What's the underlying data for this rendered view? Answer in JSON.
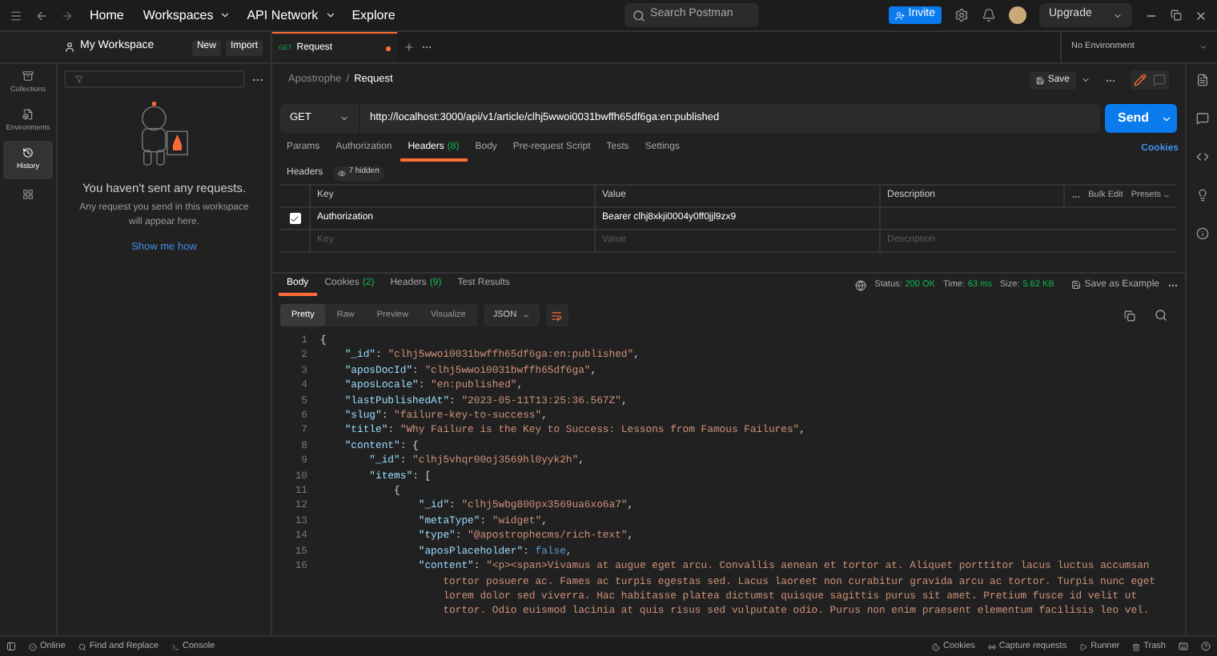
{
  "top_bar": {
    "nav": [
      {
        "label": "Home",
        "has_menu": false
      },
      {
        "label": "Workspaces",
        "has_menu": true
      },
      {
        "label": "API Network",
        "has_menu": true
      },
      {
        "label": "Explore",
        "has_menu": false
      }
    ],
    "search": {
      "placeholder": "Search Postman"
    },
    "invite": "Invite",
    "upgrade": "Upgrade"
  },
  "workspace": {
    "name": "My Workspace",
    "buttons": [
      "New",
      "Import"
    ]
  },
  "rail": [
    {
      "label": "Collections",
      "selected": false
    },
    {
      "label": "Environments",
      "selected": false
    },
    {
      "label": "History",
      "selected": true
    }
  ],
  "empty_state": {
    "title": "You haven't sent any requests.",
    "text": "Any request you send in this workspace will appear here.",
    "link": "Show me how"
  },
  "tabs": [
    {
      "method": "GET",
      "title": "Request",
      "selected": true,
      "unsaved": true
    }
  ],
  "environment": "No Environment",
  "breadcrumb": {
    "parent": "Apostrophe",
    "separator": "/",
    "current": "Request"
  },
  "save": "Save",
  "request": {
    "method": "GET",
    "url": "http://localhost:3000/api/v1/article/clhj5wwoi0031bwffh65df6ga:en:published",
    "send": "Send"
  },
  "request_tabs": [
    {
      "label": "Params",
      "selected": false
    },
    {
      "label": "Authorization",
      "selected": false
    },
    {
      "label": "Headers",
      "count": "(8)",
      "selected": true
    },
    {
      "label": "Body",
      "selected": false
    },
    {
      "label": "Pre-request Script",
      "selected": false
    },
    {
      "label": "Tests",
      "selected": false
    },
    {
      "label": "Settings",
      "selected": false
    }
  ],
  "cookies_link": "Cookies",
  "headers_bar": {
    "label": "Headers",
    "hidden": "7 hidden"
  },
  "headers_table": {
    "columns": [
      "Key",
      "Value",
      "Description"
    ],
    "actions": [
      "Bulk Edit",
      "Presets"
    ],
    "rows": [
      {
        "checked": true,
        "key": "Authorization",
        "value": "Bearer clhj8xkji0004y0ff0jjl9zx9"
      }
    ],
    "empty_row": [
      {
        "placeholder": "Key"
      },
      {
        "placeholder": "Value"
      },
      {
        "placeholder": "Description"
      }
    ]
  },
  "response_tabs": [
    {
      "label": "Body",
      "selected": true
    },
    {
      "label": "Cookies",
      "count": "(2)",
      "selected": false
    },
    {
      "label": "Headers",
      "count": "(9)",
      "selected": false
    },
    {
      "label": "Test Results",
      "selected": false
    }
  ],
  "response_meta": [
    {
      "label": "Status:",
      "value": "200 OK"
    },
    {
      "label": "Time:",
      "value": "63 ms"
    },
    {
      "label": "Size:",
      "value": "5.62 KB"
    }
  ],
  "save_example": "Save as Example",
  "view_modes": [
    {
      "label": "Pretty",
      "selected": true
    },
    {
      "label": "Raw",
      "selected": false
    },
    {
      "label": "Preview",
      "selected": false
    },
    {
      "label": "Visualize",
      "selected": false
    }
  ],
  "format": "JSON",
  "code_lines": [
    {
      "number": "1",
      "tokens": [
        {
          "kind": "punct",
          "text": "{"
        }
      ]
    },
    {
      "number": "2",
      "tokens": [
        {
          "kind": "key",
          "text": "    \"_id\""
        },
        {
          "kind": "punct",
          "text": ": "
        },
        {
          "kind": "string",
          "text": "\"clhj5wwoi0031bwffh65df6ga:en:published\""
        },
        {
          "kind": "punct",
          "text": ","
        }
      ]
    },
    {
      "number": "3",
      "tokens": [
        {
          "kind": "key",
          "text": "    \"aposDocId\""
        },
        {
          "kind": "punct",
          "text": ": "
        },
        {
          "kind": "string",
          "text": "\"clhj5wwoi0031bwffh65df6ga\""
        },
        {
          "kind": "punct",
          "text": ","
        }
      ]
    },
    {
      "number": "4",
      "tokens": [
        {
          "kind": "key",
          "text": "    \"aposLocale\""
        },
        {
          "kind": "punct",
          "text": ": "
        },
        {
          "kind": "string",
          "text": "\"en:published\""
        },
        {
          "kind": "punct",
          "text": ","
        }
      ]
    },
    {
      "number": "5",
      "tokens": [
        {
          "kind": "key",
          "text": "    \"lastPublishedAt\""
        },
        {
          "kind": "punct",
          "text": ": "
        },
        {
          "kind": "string",
          "text": "\"2023-05-11T13:25:36.567Z\""
        },
        {
          "kind": "punct",
          "text": ","
        }
      ]
    },
    {
      "number": "6",
      "tokens": [
        {
          "kind": "key",
          "text": "    \"slug\""
        },
        {
          "kind": "punct",
          "text": ": "
        },
        {
          "kind": "string",
          "text": "\"failure-key-to-success\""
        },
        {
          "kind": "punct",
          "text": ","
        }
      ]
    },
    {
      "number": "7",
      "tokens": [
        {
          "kind": "key",
          "text": "    \"title\""
        },
        {
          "kind": "punct",
          "text": ": "
        },
        {
          "kind": "string",
          "text": "\"Why Failure is the Key to Success: Lessons from Famous Failures\""
        },
        {
          "kind": "punct",
          "text": ","
        }
      ]
    },
    {
      "number": "8",
      "tokens": [
        {
          "kind": "key",
          "text": "    \"content\""
        },
        {
          "kind": "punct",
          "text": ": {"
        }
      ]
    },
    {
      "number": "9",
      "tokens": [
        {
          "kind": "key",
          "text": "        \"_id\""
        },
        {
          "kind": "punct",
          "text": ": "
        },
        {
          "kind": "string",
          "text": "\"clhj5vhqr00oj3569hl0yyk2h\""
        },
        {
          "kind": "punct",
          "text": ","
        }
      ]
    },
    {
      "number": "10",
      "tokens": [
        {
          "kind": "key",
          "text": "        \"items\""
        },
        {
          "kind": "punct",
          "text": ": ["
        }
      ]
    },
    {
      "number": "11",
      "tokens": [
        {
          "kind": "punct",
          "text": "            {"
        }
      ]
    },
    {
      "number": "12",
      "tokens": [
        {
          "kind": "key",
          "text": "                \"_id\""
        },
        {
          "kind": "punct",
          "text": ": "
        },
        {
          "kind": "string",
          "text": "\"clhj5wbg800px3569ua6xo6a7\""
        },
        {
          "kind": "punct",
          "text": ","
        }
      ]
    },
    {
      "number": "13",
      "tokens": [
        {
          "kind": "key",
          "text": "                \"metaType\""
        },
        {
          "kind": "punct",
          "text": ": "
        },
        {
          "kind": "string",
          "text": "\"widget\""
        },
        {
          "kind": "punct",
          "text": ","
        }
      ]
    },
    {
      "number": "14",
      "tokens": [
        {
          "kind": "key",
          "text": "                \"type\""
        },
        {
          "kind": "punct",
          "text": ": "
        },
        {
          "kind": "string",
          "text": "\"@apostrophecms/rich-text\""
        },
        {
          "kind": "punct",
          "text": ","
        }
      ]
    },
    {
      "number": "15",
      "tokens": [
        {
          "kind": "key",
          "text": "                \"aposPlaceholder\""
        },
        {
          "kind": "punct",
          "text": ": "
        },
        {
          "kind": "literal",
          "text": "false"
        },
        {
          "kind": "punct",
          "text": ","
        }
      ]
    },
    {
      "number": "16",
      "tokens": [
        {
          "kind": "key",
          "text": "                \"content\""
        },
        {
          "kind": "punct",
          "text": ": "
        },
        {
          "kind": "string",
          "text": "\"<p><span>Vivamus at augue eget arcu. Convallis aenean et tortor at. Aliquet porttitor lacus luctus accumsan"
        }
      ]
    },
    {
      "tokens": [
        {
          "kind": "string",
          "text": "                    tortor posuere ac. Fames ac turpis egestas sed. Lacus laoreet non curabitur gravida arcu ac tortor. Turpis nunc eget"
        }
      ]
    },
    {
      "tokens": [
        {
          "kind": "string",
          "text": "                    lorem dolor sed viverra. Hac habitasse platea dictumst quisque sagittis purus sit amet. Pretium fusce id velit ut"
        }
      ]
    },
    {
      "tokens": [
        {
          "kind": "string",
          "text": "                    tortor. Odio euismod lacinia at quis risus sed vulputate odio. Purus non enim praesent elementum facilisis leo vel."
        }
      ]
    }
  ],
  "status_bar": {
    "left": [
      "Online",
      "Find and Replace",
      "Console"
    ],
    "right": [
      "Cookies",
      "Capture requests",
      "Runner",
      "Trash"
    ]
  }
}
